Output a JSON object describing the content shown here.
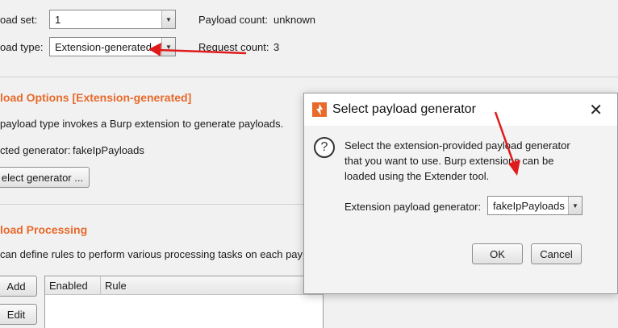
{
  "payload_set": {
    "label": "oad set:",
    "value": "1"
  },
  "payload_type": {
    "label": "oad type:",
    "value": "Extension-generated"
  },
  "counts": {
    "payload_count_label": "Payload count:",
    "payload_count_value": "unknown",
    "request_count_label": "Request count:",
    "request_count_value": "3"
  },
  "options": {
    "title": "load Options [Extension-generated]",
    "description": "payload type invokes a Burp extension to generate payloads.",
    "selected_label": "cted generator:",
    "selected_value": "fakeIpPayloads",
    "select_button": "elect generator ..."
  },
  "processing": {
    "title": "load Processing",
    "description": "can define rules to perform various processing tasks on each pay",
    "add_button": "Add",
    "edit_button": "Edit",
    "columns": [
      "Enabled",
      "Rule"
    ]
  },
  "dialog": {
    "title": "Select payload generator",
    "message_lines": [
      "Select the extension-provided payload generator",
      "that you want to use. Burp extensions can be",
      "loaded using the Extender tool."
    ],
    "generator_label": "Extension payload generator:",
    "generator_value": "fakeIpPayloads",
    "ok_button": "OK",
    "cancel_button": "Cancel",
    "close_symbol": "✕"
  },
  "colors": {
    "accent": "#e8692a",
    "annotation_arrow": "#e01b1b"
  },
  "icons": {
    "dropdown": "▼",
    "question": "?"
  }
}
